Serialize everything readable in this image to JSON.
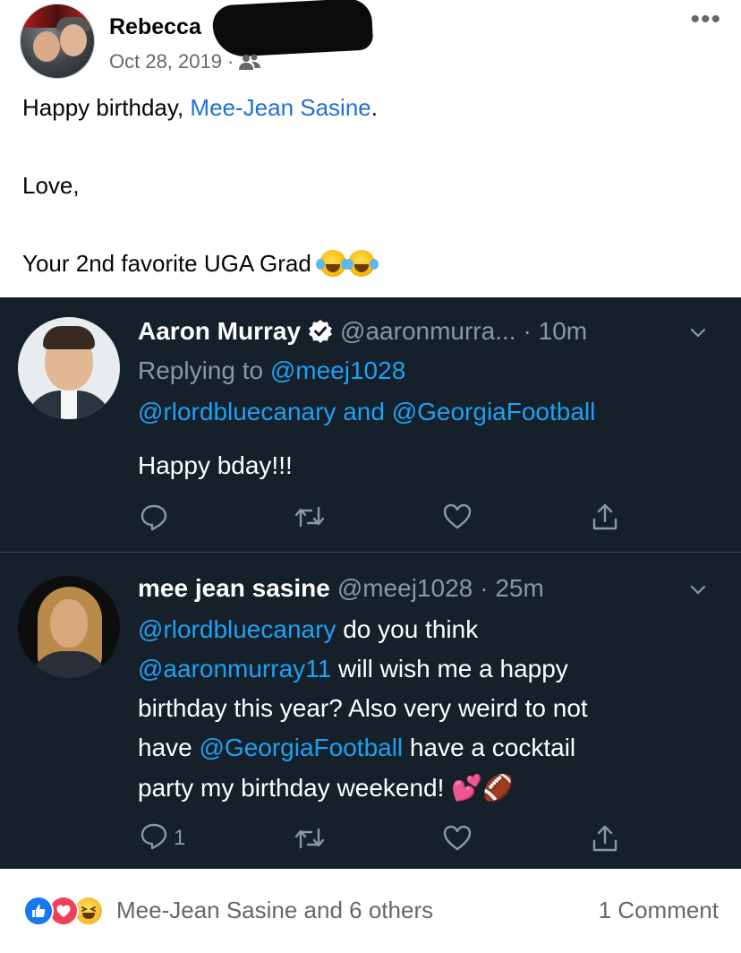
{
  "post": {
    "author_name": "Rebecca",
    "date": "Oct 28, 2019",
    "separator": "·",
    "audience_icon": "friends-icon",
    "more_icon": "more-options-icon",
    "line1_prefix": "Happy birthday, ",
    "line1_mention": "Mee-Jean Sasine",
    "line1_suffix": ".",
    "line2": "Love,",
    "line3": "Your 2nd favorite UGA Grad",
    "line3_emoji": "face-with-tears-of-joy"
  },
  "tweets": [
    {
      "name": "Aaron Murray",
      "verified": true,
      "handle": "@aaronmurra...",
      "time": "· 10m",
      "reply_prefix": "Replying to ",
      "reply_to_1": "@meej1028",
      "reply_to_2": "@rlordbluecanary",
      "reply_and": " and ",
      "reply_to_3": "@GeorgiaFootball",
      "text": "Happy bday!!!",
      "reply_count": ""
    },
    {
      "name": "mee jean sasine",
      "handle": "@meej1028",
      "time": "· 25m",
      "line1_mention": "@rlordbluecanary",
      "line1_text": " do you think",
      "line2_mention": "@aaronmurray11",
      "line2_text": " will wish me a happy",
      "line3": "birthday this year? Also very weird to not",
      "line4_prefix": "have ",
      "line4_mention": "@GeorgiaFootball",
      "line4_text": " have a cocktail",
      "line5": "party my birthday weekend! 💕🏈",
      "reply_count": "1"
    }
  ],
  "footer": {
    "reactions": [
      "like",
      "love",
      "haha"
    ],
    "reaction_text": "Mee-Jean Sasine and 6 others",
    "comment_count": "1 Comment"
  },
  "colors": {
    "fb_link": "#216fdb",
    "fb_grey": "#65676b",
    "twitter_bg": "#15202b",
    "twitter_blue": "#1da1f2",
    "twitter_grey": "#8899a6"
  }
}
